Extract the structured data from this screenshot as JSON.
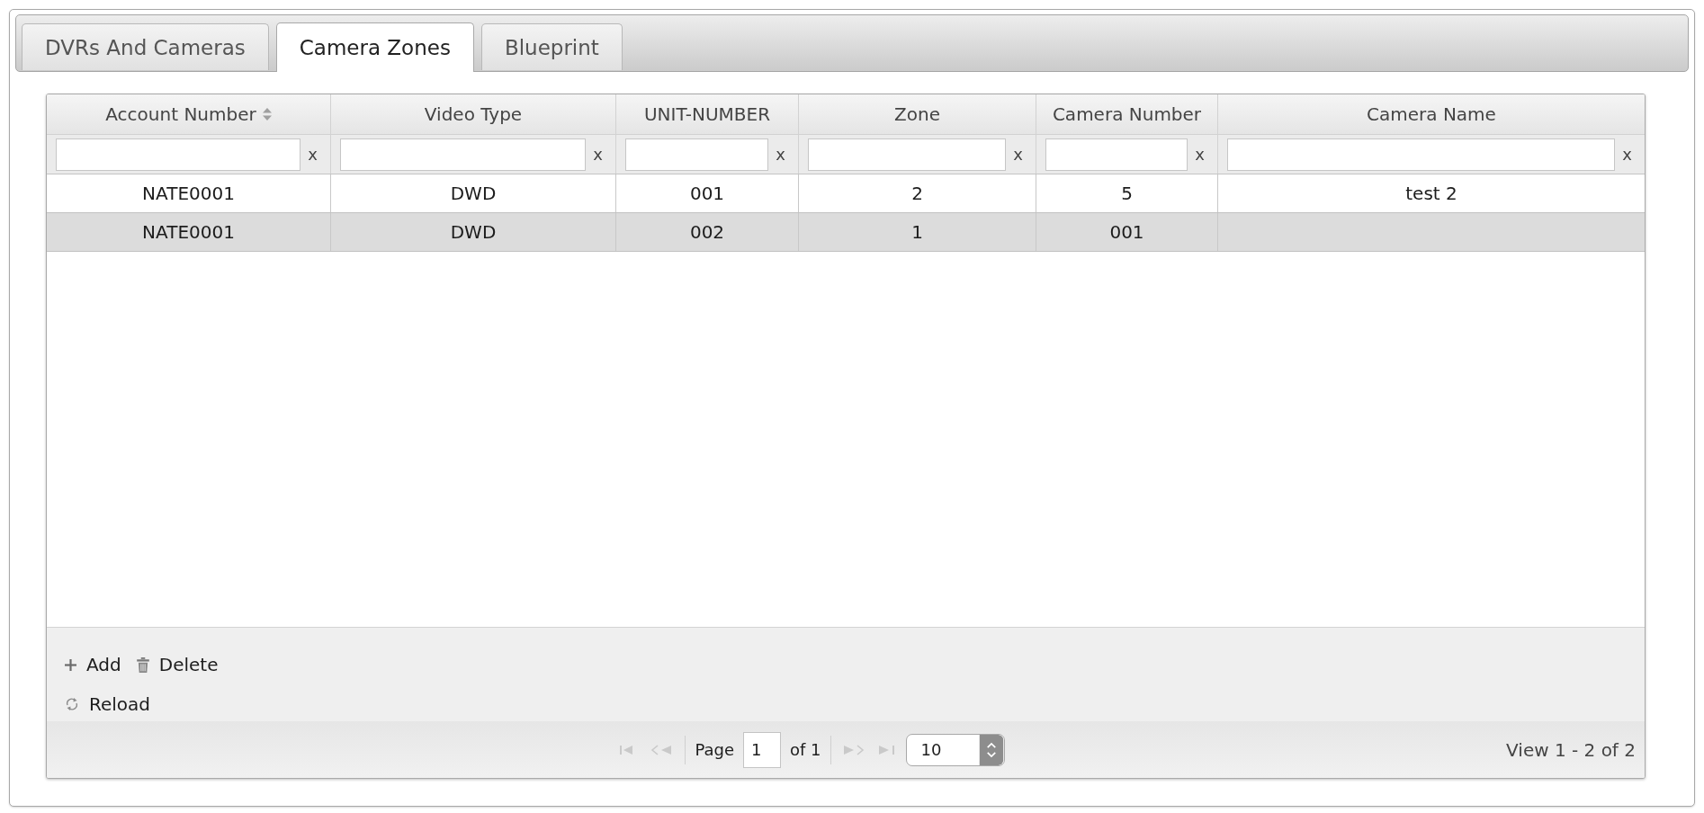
{
  "tabs": [
    {
      "label": "DVRs And Cameras",
      "selected": false
    },
    {
      "label": "Camera Zones",
      "selected": true
    },
    {
      "label": "Blueprint",
      "selected": false
    }
  ],
  "grid": {
    "columns": [
      {
        "title": "Account Number",
        "sorted": true,
        "filter_clear": "x"
      },
      {
        "title": "Video Type",
        "sorted": false,
        "filter_clear": "x"
      },
      {
        "title": "UNIT-NUMBER",
        "sorted": false,
        "filter_clear": "x"
      },
      {
        "title": "Zone",
        "sorted": false,
        "filter_clear": "x"
      },
      {
        "title": "Camera Number",
        "sorted": false,
        "filter_clear": "x"
      },
      {
        "title": "Camera Name",
        "sorted": false,
        "filter_clear": "x"
      }
    ],
    "rows": [
      {
        "cells": [
          "NATE0001",
          "DWD",
          "001",
          "2",
          "5",
          "test 2"
        ],
        "selected": false
      },
      {
        "cells": [
          "NATE0001",
          "DWD",
          "002",
          "1",
          "001"
        ],
        "selected": true
      }
    ]
  },
  "toolbar": {
    "lines": [
      [
        {
          "kind": "add",
          "label": "Add"
        },
        {
          "kind": "delete",
          "label": "Delete"
        }
      ],
      [
        {
          "kind": "reload",
          "label": "Reload"
        }
      ]
    ]
  },
  "pager": {
    "back_buttons": [
      {
        "kind": "first",
        "disabled": true
      },
      {
        "kind": "prev",
        "disabled": true
      }
    ],
    "page_label": "Page",
    "page": "1",
    "of_label": "of 1",
    "forward_buttons": [
      {
        "kind": "next",
        "disabled": true
      },
      {
        "kind": "last",
        "disabled": true
      }
    ],
    "page_size": "10",
    "summary": "View 1 - 2 of 2"
  }
}
